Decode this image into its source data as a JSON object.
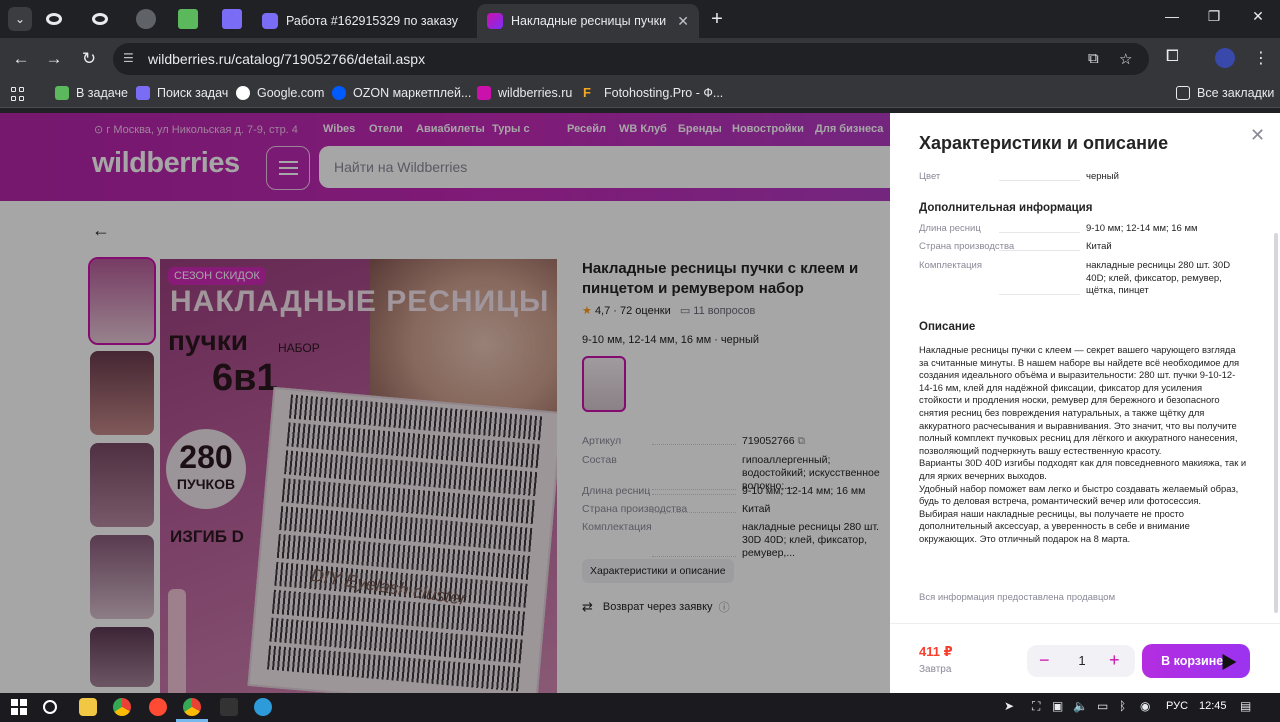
{
  "browser": {
    "tabs": [
      {
        "title": "Работа #162915329 по заказу",
        "active": false
      },
      {
        "title": "Накладные ресницы пучки с к",
        "active": true
      }
    ],
    "url": "wildberries.ru/catalog/719052766/detail.aspx",
    "bookmarks": [
      "В задаче",
      "Поиск задач",
      "Google.com",
      "OZON маркетплей...",
      "wildberries.ru",
      "Fotohosting.Pro - Ф..."
    ],
    "all_bookmarks": "Все закладки"
  },
  "header": {
    "location": "г Москва, ул Никольская д. 7-9, стр. 4",
    "nav": [
      "Wibes",
      "Отели",
      "Авиабилеты",
      "Туры с",
      "Ресейл",
      "WB Клуб",
      "Бренды",
      "Новостройки",
      "Для бизнеса"
    ],
    "logo": "wildberries",
    "search_placeholder": "Найти на Wildberries"
  },
  "hero": {
    "badge": "СЕЗОН СКИДОК",
    "title": "НАКЛАДНЫЕ РЕСНИЦЫ",
    "sub": "пучки",
    "nabor": "НАБОР",
    "six_in_one": "6в1",
    "count": "280",
    "count_label": "ПУЧКОВ",
    "izgib": "ИЗГИБ D",
    "brand": "DIY Eyelash cluster"
  },
  "product": {
    "title": "Накладные ресницы пучки с клеем и пинцетом и ремувером набор",
    "rating": "4,7",
    "reviews": "72 оценки",
    "questions": "11 вопросов",
    "variant": "9-10 мм, 12-14 мм, 16 мм · черный",
    "specs": [
      {
        "k": "Артикул",
        "v": "719052766"
      },
      {
        "k": "Состав",
        "v": "гипоаллергенный; водостойкий; искусственное волокно;..."
      },
      {
        "k": "Длина ресниц",
        "v": "9-10 мм; 12-14 мм; 16 мм"
      },
      {
        "k": "Страна производства",
        "v": "Китай"
      },
      {
        "k": "Комплектация",
        "v": "накладные ресницы 280 шт. 30D 40D; клей, фиксатор, ремувер,..."
      }
    ],
    "chars_button": "Характеристики и описание",
    "returns": "Возврат через заявку"
  },
  "panel": {
    "title": "Характеристики и описание",
    "color_key": "Цвет",
    "color_value": "черный",
    "extra_title": "Дополнительная информация",
    "extra": [
      {
        "k": "Длина ресниц",
        "v": "9-10 мм; 12-14 мм; 16 мм"
      },
      {
        "k": "Страна производства",
        "v": "Китай"
      },
      {
        "k": "Комплектация",
        "v": "накладные ресницы 280 шт. 30D 40D; клей, фиксатор, ремувер, щётка, пинцет"
      }
    ],
    "desc_title": "Описание",
    "description": "Накладные ресницы пучки с клеем — секрет вашего чарующего взгляда за считанные минуты. В нашем наборе вы найдете всё необходимое для создания идеального объёма и выразительности: 280 шт. пучки 9-10-12-14-16 мм, клей для надёжной фиксации, фиксатор для усиления стойкости и продления носки, ремувер для бережного и безопасного снятия ресниц без повреждения натуральных, а также щётку для аккуратного расчесывания и выравнивания. Это значит, что вы получите полный комплект пучковых ресниц для лёгкого и аккуратного нанесения, позволяющий подчеркнуть вашу естественную красоту.\nВарианты 30D 40D изгибы подходят как для повседневного макияжа, так и для ярких вечерних выходов.\nУдобный набор поможет вам легко и быстро создавать желаемый образ, будь то деловая встреча, романтический вечер или фотосессия.\nВыбирая наши накладные ресницы, вы получаете не просто дополнительный аксессуар, а уверенность в себе и внимание окружающих. Это отличный подарок на 8 марта.",
    "seller_note": "Вся информация предоставлена продавцом",
    "price": "411 ₽",
    "delivery": "Завтра",
    "qty": "1",
    "cart_button": "В корзине"
  },
  "taskbar": {
    "lang": "РУС",
    "time": "12:45"
  },
  "colors": {
    "brand": "#cb11ab",
    "price": "#f73f2d",
    "accent": "#9b33f0"
  }
}
